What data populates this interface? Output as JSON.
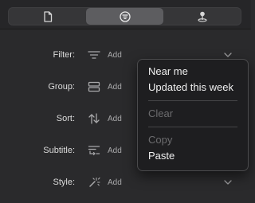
{
  "tabs": [
    {
      "icon": "document-icon",
      "active": false
    },
    {
      "icon": "filter-circle-icon",
      "active": true
    },
    {
      "icon": "map-pin-icon",
      "active": false
    }
  ],
  "rows": {
    "filter": {
      "label": "Filter:",
      "action": "Add",
      "icon": "filter-lines-icon"
    },
    "group": {
      "label": "Group:",
      "action": "Add",
      "icon": "group-rows-icon"
    },
    "sort": {
      "label": "Sort:",
      "action": "Add",
      "icon": "sort-arrows-icon"
    },
    "subtitle": {
      "label": "Subtitle:",
      "action": "Add",
      "icon": "subtitle-icon"
    },
    "style": {
      "label": "Style:",
      "action": "Add",
      "icon": "magic-wand-icon"
    }
  },
  "menu": {
    "near_me": "Near me",
    "updated_this_week": "Updated this week",
    "clear": "Clear",
    "copy": "Copy",
    "paste": "Paste"
  }
}
